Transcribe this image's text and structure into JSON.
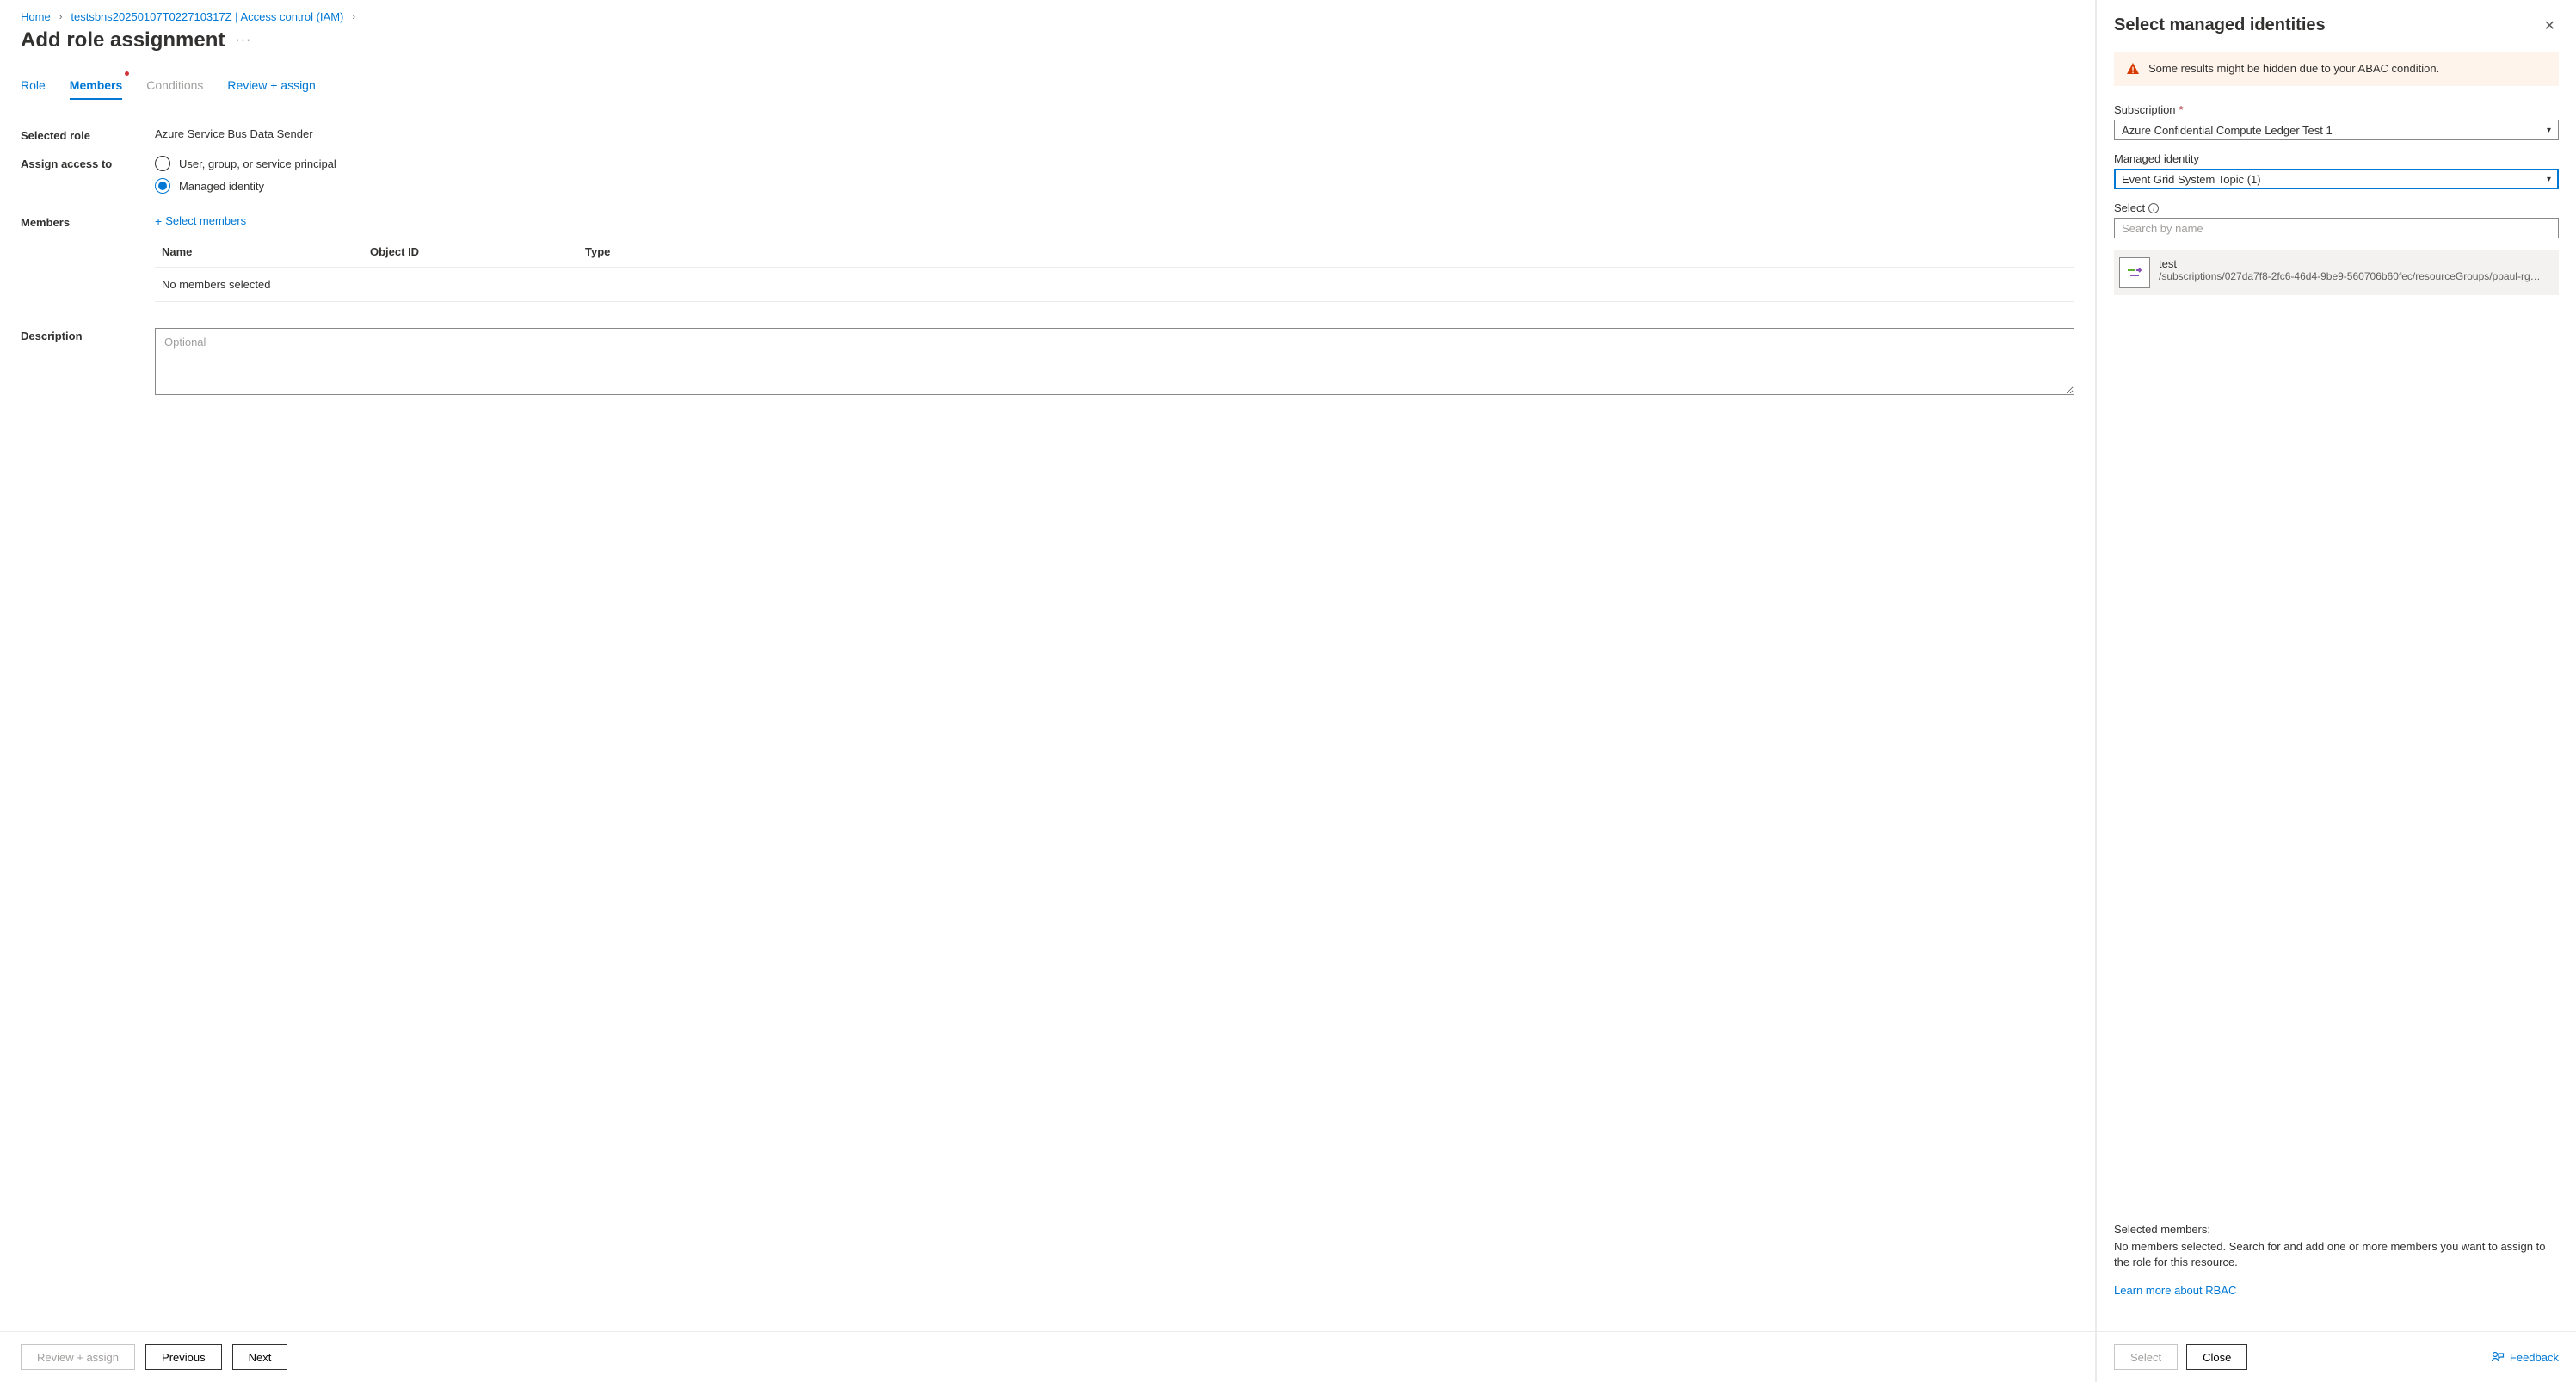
{
  "breadcrumb": {
    "home": "Home",
    "resource": "testsbns20250107T022710317Z | Access control (IAM)"
  },
  "page_title": "Add role assignment",
  "tabs": {
    "role": "Role",
    "members": "Members",
    "conditions": "Conditions",
    "review": "Review + assign"
  },
  "form": {
    "selected_role_label": "Selected role",
    "selected_role_value": "Azure Service Bus Data Sender",
    "assign_access_label": "Assign access to",
    "radio_user": "User, group, or service principal",
    "radio_managed": "Managed identity",
    "members_label": "Members",
    "select_members": "Select members",
    "description_label": "Description",
    "description_placeholder": "Optional"
  },
  "members_table": {
    "col_name": "Name",
    "col_object": "Object ID",
    "col_type": "Type",
    "empty": "No members selected"
  },
  "footer": {
    "review": "Review + assign",
    "previous": "Previous",
    "next": "Next"
  },
  "panel": {
    "title": "Select managed identities",
    "warning": "Some results might be hidden due to your ABAC condition.",
    "subscription_label": "Subscription",
    "subscription_value": "Azure Confidential Compute Ledger Test 1",
    "managed_identity_label": "Managed identity",
    "managed_identity_value": "Event Grid System Topic (1)",
    "select_label": "Select",
    "search_placeholder": "Search by name",
    "result_name": "test",
    "result_sub": "/subscriptions/027da7f8-2fc6-46d4-9be9-560706b60fec/resourceGroups/ppaul-rg…",
    "selected_members_label": "Selected members:",
    "selected_members_help": "No members selected. Search for and add one or more members you want to assign to the role for this resource.",
    "learn_more": "Learn more about RBAC",
    "select_btn": "Select",
    "close_btn": "Close",
    "feedback": "Feedback"
  }
}
